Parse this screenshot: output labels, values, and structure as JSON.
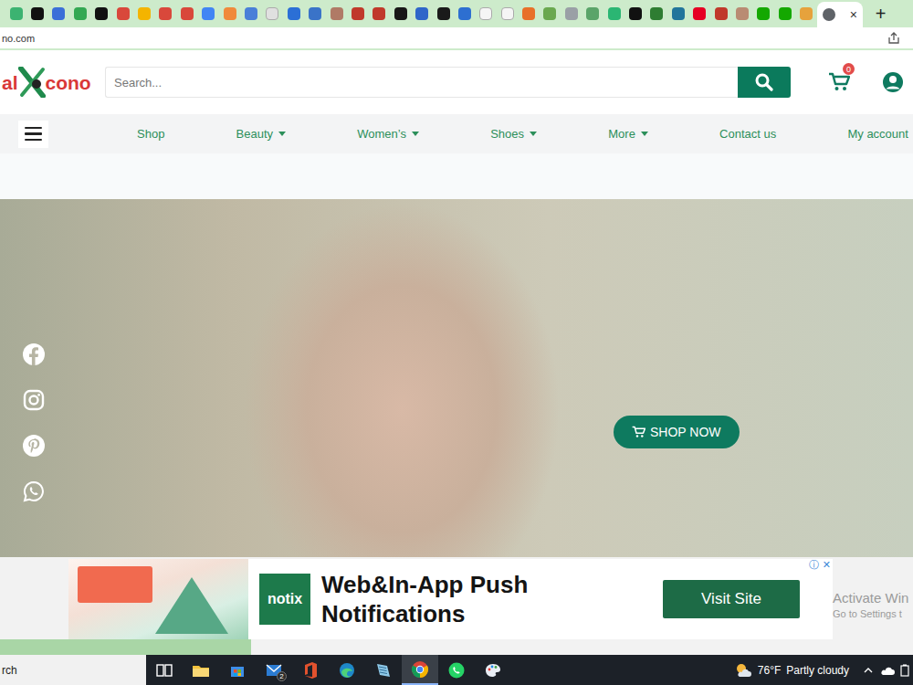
{
  "browser": {
    "tabs": [
      {
        "color": "#3cb371",
        "selected": false
      },
      {
        "color": "#111111",
        "selected": false
      },
      {
        "color": "#3b6fd8",
        "selected": false
      },
      {
        "color": "#34a853",
        "selected": false
      },
      {
        "color": "#111111",
        "selected": false
      },
      {
        "color": "#d9483b",
        "selected": false
      },
      {
        "color": "#f4b400",
        "selected": false
      },
      {
        "color": "#d9483b",
        "selected": false
      },
      {
        "color": "#d9483b",
        "selected": false
      },
      {
        "color": "#4285f4",
        "selected": false
      },
      {
        "color": "#f08a3c",
        "selected": false
      },
      {
        "color": "#4a7fd8",
        "selected": false
      },
      {
        "color": "#e0e0e0",
        "selected": false
      },
      {
        "color": "#2b6fd6",
        "selected": false
      },
      {
        "color": "#3a73c8",
        "selected": false
      },
      {
        "color": "#b07a66",
        "selected": false
      },
      {
        "color": "#c0392b",
        "selected": false
      },
      {
        "color": "#c0392b",
        "selected": false
      },
      {
        "color": "#181717",
        "selected": false
      },
      {
        "color": "#2f66c9",
        "selected": false
      },
      {
        "color": "#1a1a1a",
        "selected": false
      },
      {
        "color": "#2d6fd1",
        "selected": false
      },
      {
        "color": "#f5f5f5",
        "selected": false
      },
      {
        "color": "#f5f5f5",
        "selected": false
      },
      {
        "color": "#e8702a",
        "selected": false
      },
      {
        "color": "#6aa84f",
        "selected": false
      },
      {
        "color": "#9aa0a6",
        "selected": false
      },
      {
        "color": "#5aa469",
        "selected": false
      },
      {
        "color": "#2bb673",
        "selected": false
      },
      {
        "color": "#111111",
        "selected": false
      },
      {
        "color": "#2e7d32",
        "selected": false
      },
      {
        "color": "#21759b",
        "selected": false
      },
      {
        "color": "#e60023",
        "selected": false
      },
      {
        "color": "#c0392b",
        "selected": false
      },
      {
        "color": "#b98b73",
        "selected": false
      },
      {
        "color": "#14a800",
        "selected": false
      },
      {
        "color": "#14a800",
        "selected": false
      },
      {
        "color": "#e6a23c",
        "selected": false
      },
      {
        "color": "#5f6368",
        "selected": true
      }
    ],
    "close_icon": "×",
    "new_tab": "+",
    "address": "no.com"
  },
  "site": {
    "logo": {
      "left": "al",
      "right": "cono"
    },
    "search": {
      "placeholder": "Search..."
    },
    "cart": {
      "count": "0"
    },
    "nav": [
      {
        "label": "Shop",
        "dropdown": false
      },
      {
        "label": "Beauty",
        "dropdown": true
      },
      {
        "label": "Women’s",
        "dropdown": true
      },
      {
        "label": "Shoes",
        "dropdown": true
      },
      {
        "label": "More",
        "dropdown": true
      },
      {
        "label": "Contact us",
        "dropdown": false
      },
      {
        "label": "My account",
        "dropdown": false
      }
    ],
    "hero": {
      "button": "SHOP NOW"
    }
  },
  "ad": {
    "brand": "notix",
    "title": [
      "Web&In-App Push",
      "Notifications"
    ],
    "button": "Visit Site",
    "info_icon": "ⓘ",
    "close_icon": "✕"
  },
  "watermark": {
    "line1": "Activate Win",
    "line2": "Go to Settings t"
  },
  "taskbar": {
    "search": "rch",
    "apps": [
      {
        "kind": "taskview",
        "selected": false
      },
      {
        "kind": "explorer",
        "selected": false
      },
      {
        "kind": "store",
        "selected": false
      },
      {
        "kind": "mail",
        "selected": false,
        "badge": "2"
      },
      {
        "kind": "office",
        "selected": false
      },
      {
        "kind": "edge",
        "selected": false
      },
      {
        "kind": "notes",
        "selected": false
      },
      {
        "kind": "chrome",
        "selected": true
      },
      {
        "kind": "whatsapp",
        "selected": false
      },
      {
        "kind": "paint",
        "selected": false
      }
    ],
    "weather": {
      "temp": "76°F",
      "text": "Partly cloudy"
    }
  }
}
